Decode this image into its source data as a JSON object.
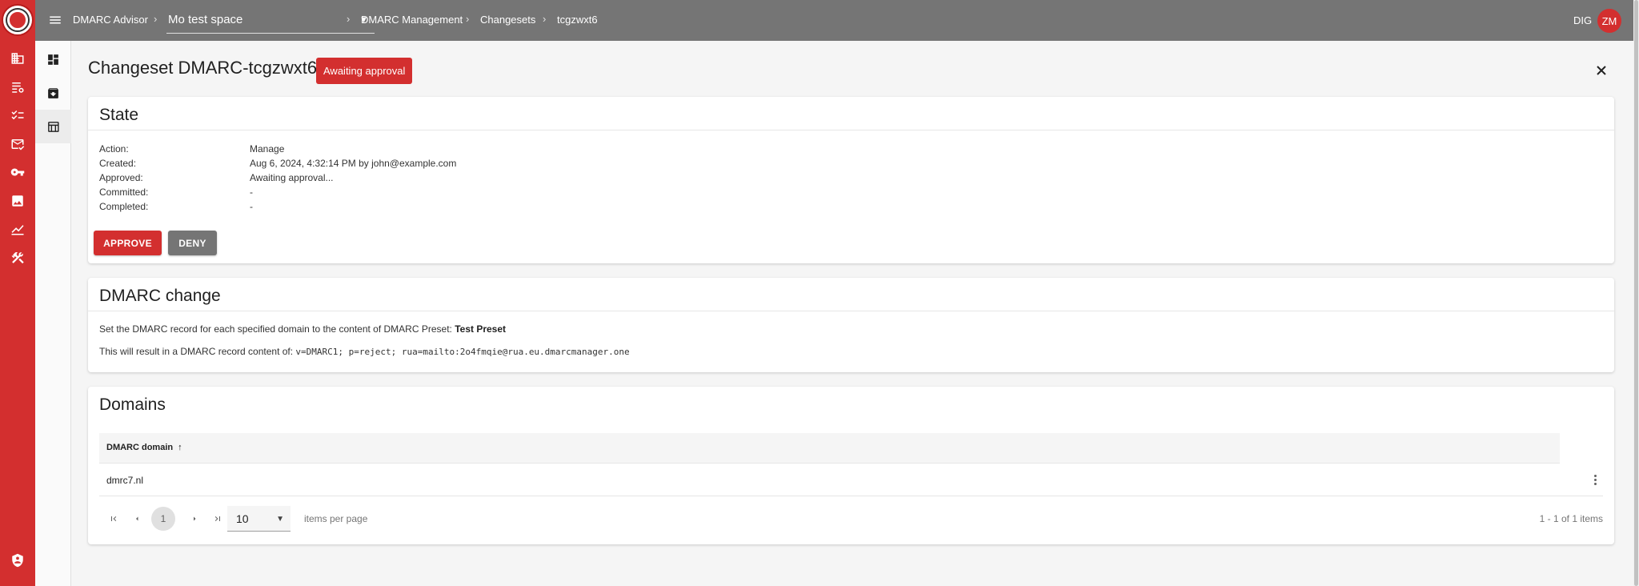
{
  "rail": {
    "icons": [
      "dmarc-logo-icon",
      "domains-icon",
      "domain-settings-icon",
      "checklist-icon",
      "mail-check-icon",
      "key-icon",
      "image-icon",
      "analytics-icon",
      "tools-icon",
      "shield-user-icon"
    ]
  },
  "side2": {
    "icons": [
      "dashboard-icon",
      "archive-icon",
      "table-icon"
    ]
  },
  "topbar": {
    "app_name": "DMARC Advisor",
    "space": "Mo test space",
    "breadcrumb": [
      "DMARC Management",
      "Changesets",
      "tcgzwxt6"
    ],
    "org": "DIG",
    "avatar_initials": "ZM"
  },
  "page": {
    "title": "Changeset DMARC-tcgzwxt6",
    "status": "Awaiting approval"
  },
  "state": {
    "heading": "State",
    "rows": [
      {
        "label": "Action:",
        "value": "Manage"
      },
      {
        "label": "Created:",
        "value": "Aug 6, 2024, 4:32:14 PM by john@example.com"
      },
      {
        "label": "Approved:",
        "value": "Awaiting approval..."
      },
      {
        "label": "Committed:",
        "value": "-"
      },
      {
        "label": "Completed:",
        "value": "-"
      }
    ],
    "approve_label": "APPROVE",
    "deny_label": "DENY"
  },
  "dmarc_change": {
    "heading": "DMARC change",
    "line1_prefix": "Set the DMARC record for each specified domain to the content of DMARC Preset: ",
    "preset_name": "Test Preset",
    "line2_prefix": "This will result in a DMARC record content of: ",
    "record": "v=DMARC1; p=reject; rua=mailto:2o4fmqie@rua.eu.dmarcmanager.one"
  },
  "domains": {
    "heading": "Domains",
    "column": "DMARC domain",
    "sort_arrow": "↑",
    "rows": [
      "dmrc7.nl"
    ],
    "current_page": "1",
    "per_page": "10",
    "items_per_page_label": "items per page",
    "range_text": "1 - 1 of 1 items"
  },
  "colors": {
    "brand_red": "#d32f2f",
    "topbar_gray": "#757575"
  }
}
